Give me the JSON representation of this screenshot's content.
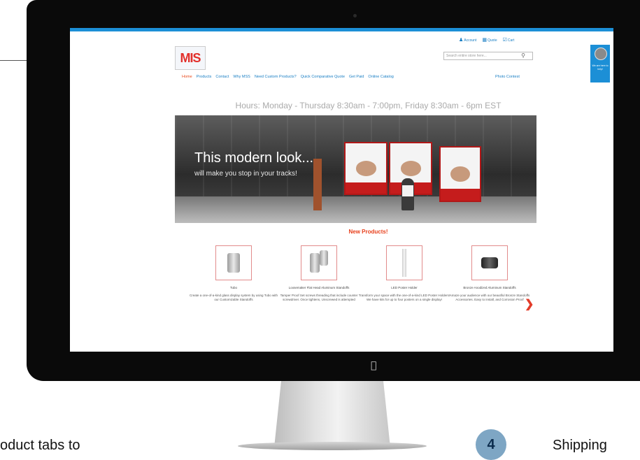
{
  "header": {
    "logo_text": "MIS",
    "top_links": [
      "Account",
      "Quote",
      "Cart"
    ],
    "search_placeholder": "Search entire store here..."
  },
  "nav": {
    "items": [
      "Home",
      "Products",
      "Contact",
      "Why MSS",
      "Need Custom Products?",
      "Quick Comparative Quote",
      "Get Paid",
      "Online Catalog"
    ],
    "right_item": "Photo Contest"
  },
  "hours": "Hours: Monday - Thursday 8:30am - 7:00pm, Friday 8:30am - 6pm EST",
  "banner": {
    "headline": "This modern look...",
    "subline": "will make you stop in your tracks!"
  },
  "new_products": {
    "title": "New Products!",
    "items": [
      {
        "name": "Tubo",
        "desc": "Create a one-of-a-kind glass display system by using Tubo with our Customizable Standoffs"
      },
      {
        "name": "Loosemaker Flat Head Aluminum Standoffs",
        "desc": "Tamper Proof Set screws threading that include counter screwdriver. Once tightens, Unscrewed is attempted"
      },
      {
        "name": "LED Poster Holder",
        "desc": "Transform your space with the one-of-a-kind LED Poster Holders! We have kits for up to four posters on a single display!"
      },
      {
        "name": "Bronze Anodized Aluminum Standoffs",
        "desc": "Amaze your audience with our beautiful Bronze Standoffs Accessories. Easy to install, and Corrosion Proof"
      }
    ]
  },
  "chat": {
    "label": "We are here to help!"
  },
  "page_bottom": {
    "left_text": "oduct tabs to",
    "step_number": "4",
    "right_text": "Shipping"
  },
  "colors": {
    "accent": "#1c8fd6",
    "nav_active": "#e84a1c",
    "product_title": "#e8401c"
  }
}
